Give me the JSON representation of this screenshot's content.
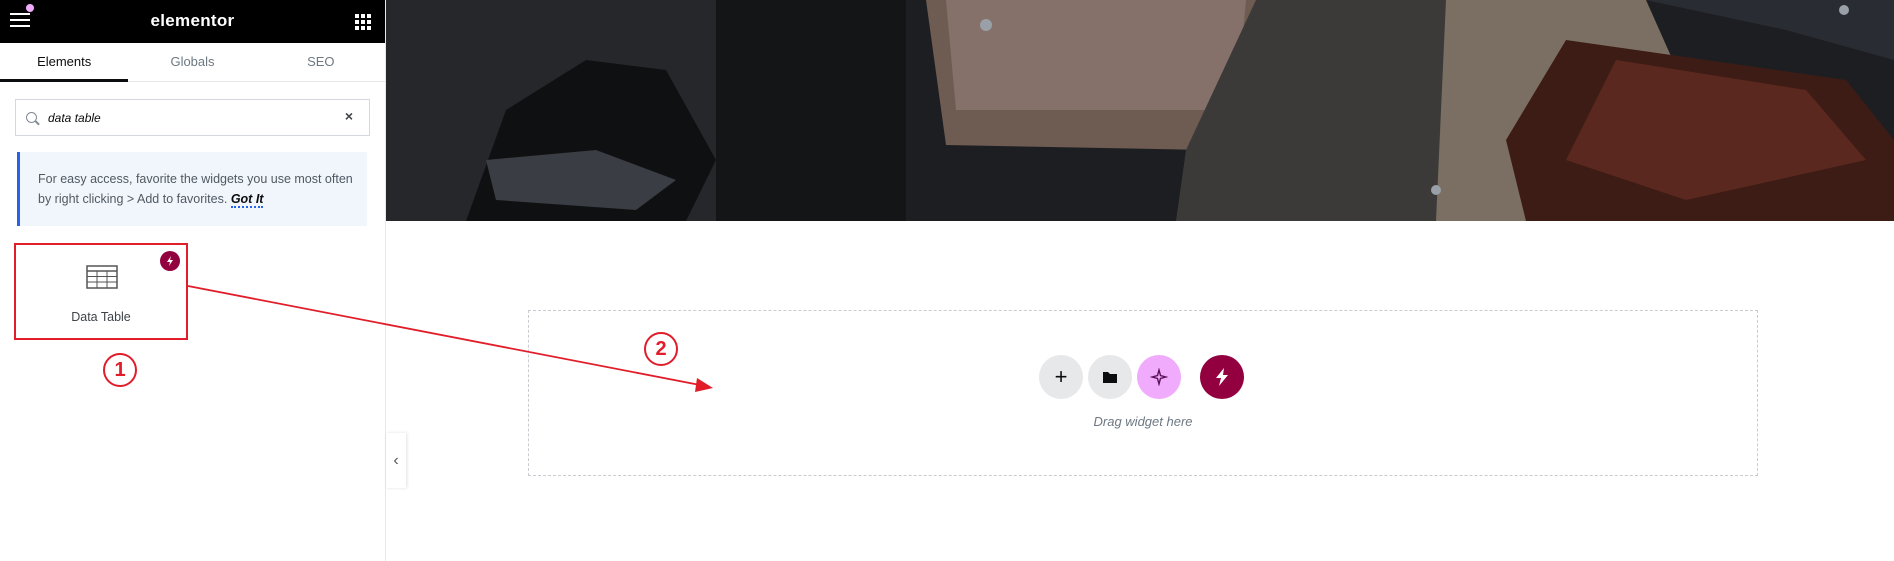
{
  "topbar": {
    "brand": "elementor"
  },
  "tabs": [
    {
      "label": "Elements"
    },
    {
      "label": "Globals"
    },
    {
      "label": "SEO"
    }
  ],
  "search": {
    "value": "data table",
    "clear_symbol": "×"
  },
  "notice": {
    "text": "For easy access, favorite the widgets you use most often by right clicking > Add to favorites.",
    "link": "Got It"
  },
  "widget": {
    "label": "Data Table"
  },
  "steps": [
    "1",
    "2"
  ],
  "dropzone": {
    "hint": "Drag widget here",
    "add_symbol": "+"
  },
  "colors": {
    "accent": "#e11d2a",
    "pro": "#93003f",
    "ai": "#f0abfc",
    "notice_border": "#2563eb"
  }
}
